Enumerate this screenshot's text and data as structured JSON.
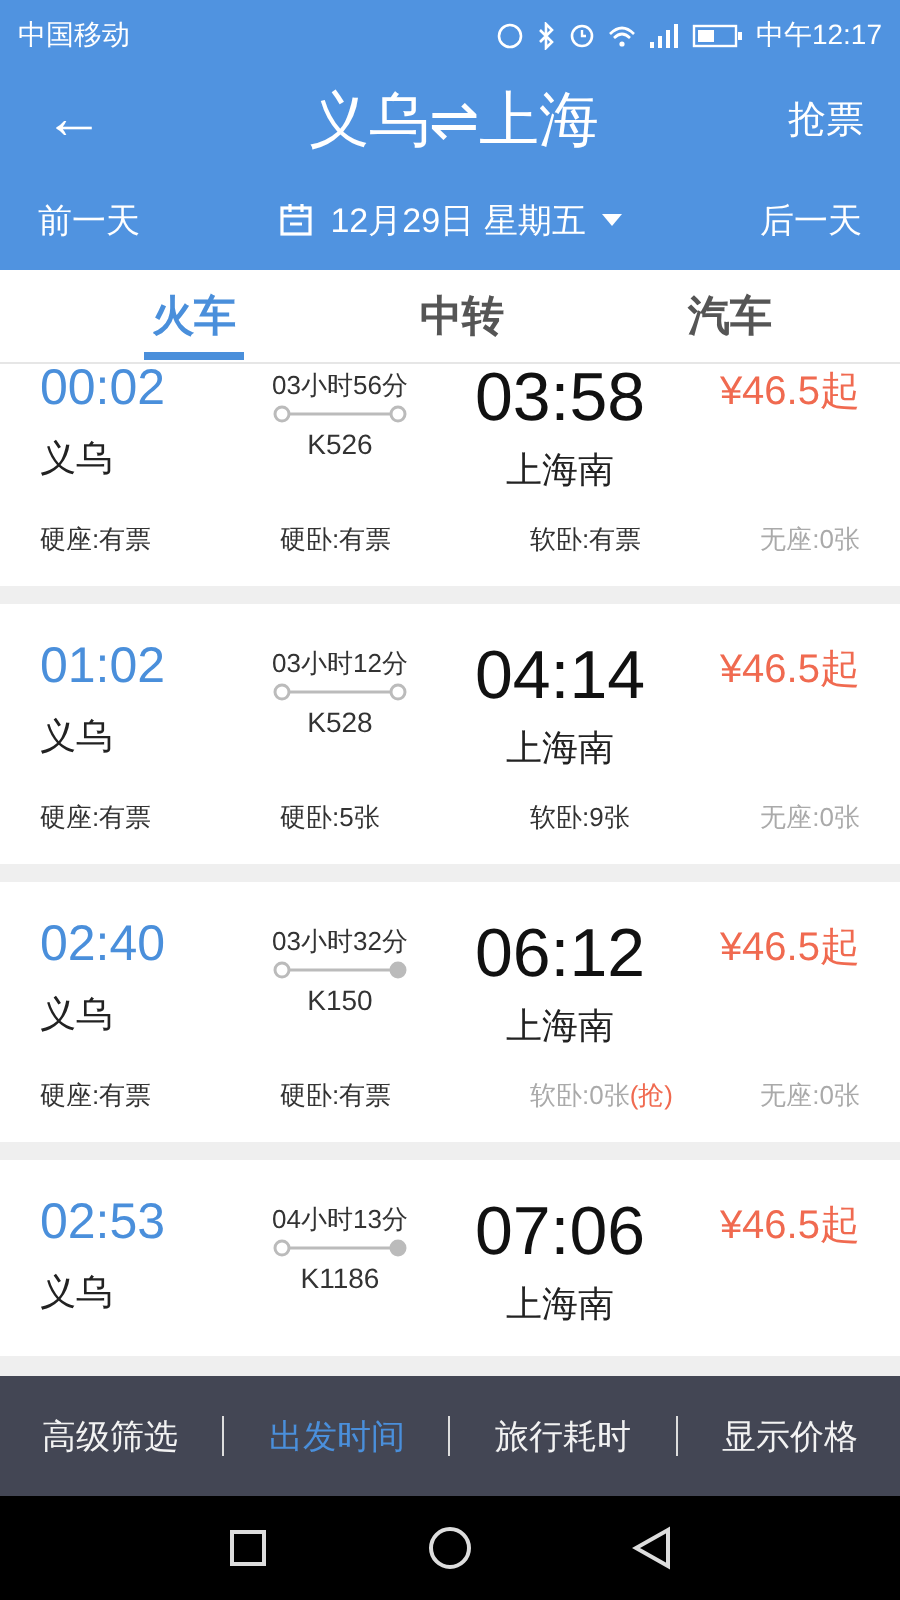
{
  "status_bar": {
    "carrier": "中国移动",
    "time": "中午12:17"
  },
  "header": {
    "back": "←",
    "title": "义乌⇌上海",
    "action": "抢票"
  },
  "date_bar": {
    "prev": "前一天",
    "date": "12月29日 星期五",
    "next": "后一天"
  },
  "tabs": [
    {
      "label": "火车",
      "selected": true
    },
    {
      "label": "中转",
      "selected": false
    },
    {
      "label": "汽车",
      "selected": false
    }
  ],
  "trains": [
    {
      "depart": "00:02",
      "from": "义乌",
      "duration": "03小时56分",
      "number": "K526",
      "arrive": "03:58",
      "to": "上海南",
      "price": "¥46.5起",
      "end_dot_filled": false,
      "seats": [
        {
          "text": "硬座:有票",
          "available": true
        },
        {
          "text": "硬卧:有票",
          "available": true
        },
        {
          "text": "软卧:有票",
          "available": true
        },
        {
          "text": "无座:0张",
          "available": false
        }
      ]
    },
    {
      "depart": "01:02",
      "from": "义乌",
      "duration": "03小时12分",
      "number": "K528",
      "arrive": "04:14",
      "to": "上海南",
      "price": "¥46.5起",
      "end_dot_filled": false,
      "seats": [
        {
          "text": "硬座:有票",
          "available": true
        },
        {
          "text": "硬卧:5张",
          "available": true
        },
        {
          "text": "软卧:9张",
          "available": true
        },
        {
          "text": "无座:0张",
          "available": false
        }
      ]
    },
    {
      "depart": "02:40",
      "from": "义乌",
      "duration": "03小时32分",
      "number": "K150",
      "arrive": "06:12",
      "to": "上海南",
      "price": "¥46.5起",
      "end_dot_filled": true,
      "seats": [
        {
          "text": "硬座:有票",
          "available": true
        },
        {
          "text": "硬卧:有票",
          "available": true
        },
        {
          "text": "软卧:0张",
          "available": false,
          "grab": "(抢)"
        },
        {
          "text": "无座:0张",
          "available": false
        }
      ]
    },
    {
      "depart": "02:53",
      "from": "义乌",
      "duration": "04小时13分",
      "number": "K1186",
      "arrive": "07:06",
      "to": "上海南",
      "price": "¥46.5起",
      "end_dot_filled": true
    }
  ],
  "bottom_bar": [
    {
      "label": "高级筛选",
      "selected": false
    },
    {
      "label": "出发时间",
      "selected": true
    },
    {
      "label": "旅行耗时",
      "selected": false
    },
    {
      "label": "显示价格",
      "selected": false
    }
  ]
}
